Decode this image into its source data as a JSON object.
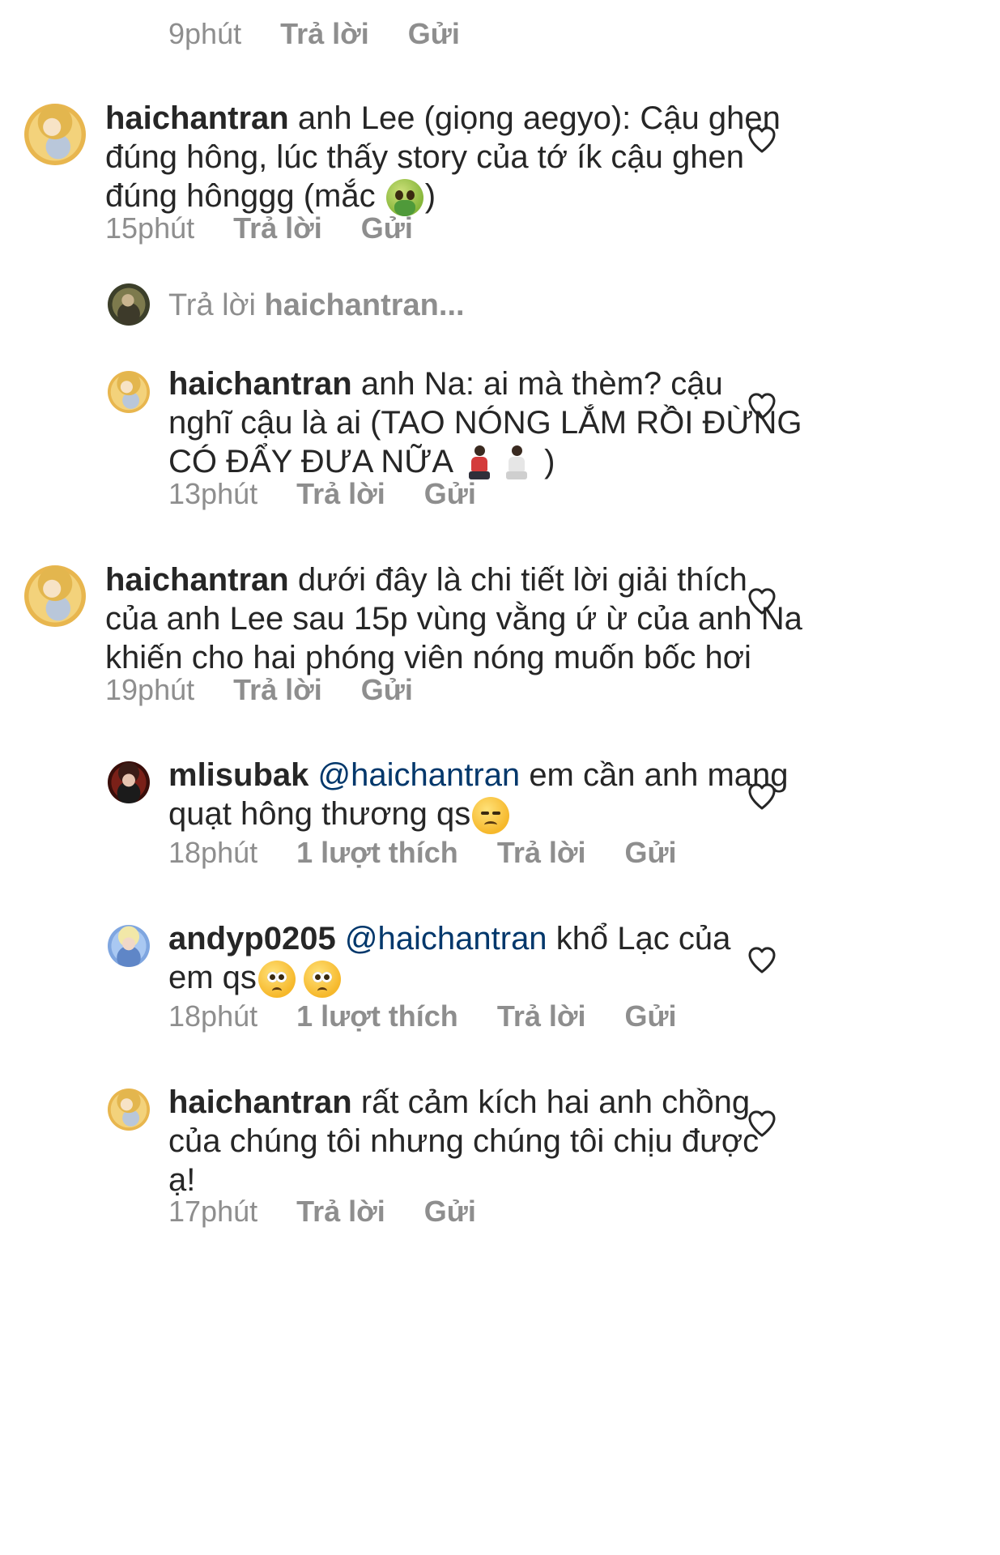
{
  "common": {
    "reply_label": "Trả lời",
    "send_label": "Gửi"
  },
  "top_meta": {
    "time": "9phút"
  },
  "comments": [
    {
      "username": "haichantran",
      "lines": [
        "anh Lee (giọng aegyo): Cậu ghen",
        "đúng hông, lúc thấy story của tớ ík cậu ghen",
        "đúng hônggg (mắc"
      ],
      "line3_end": ")",
      "time": "15phút"
    }
  ],
  "reply_composer": {
    "prefix": "Trả lời",
    "target": "haichantran..."
  },
  "reply_na": {
    "username": "haichantran",
    "lines": [
      "anh Na: ai mà thèm? cậu",
      "nghĩ cậu là ai (TAO NÓNG LẮM RỒI ĐỪNG",
      "CÓ ĐẨY ĐƯA NỮA"
    ],
    "line3_end": ")",
    "time": "13phút"
  },
  "comment2": {
    "username": "haichantran",
    "lines": [
      "dưới đây là chi tiết lời giải thích",
      "của anh Lee sau 15p vùng vằng ứ ừ của anh Na",
      "khiến cho hai phóng viên nóng muốn bốc hơi"
    ],
    "time": "19phút"
  },
  "reply_mli": {
    "username": "mlisubak",
    "mention": "@haichantran",
    "line1_rest": "em cần anh mang",
    "line2": "quạt hông thương qs",
    "time": "18phút",
    "likes": "1 lượt thích"
  },
  "reply_andy": {
    "username": "andyp0205",
    "mention": "@haichantran",
    "line1_rest": "khổ Lạc của",
    "line2": "em qs",
    "time": "18phút",
    "likes": "1 lượt thích"
  },
  "reply_hai_last": {
    "username": "haichantran",
    "lines": [
      "rất cảm kích hai anh chồng",
      "của chúng tôi nhưng chúng tôi chịu được",
      "ạ!"
    ],
    "time": "17phút"
  }
}
